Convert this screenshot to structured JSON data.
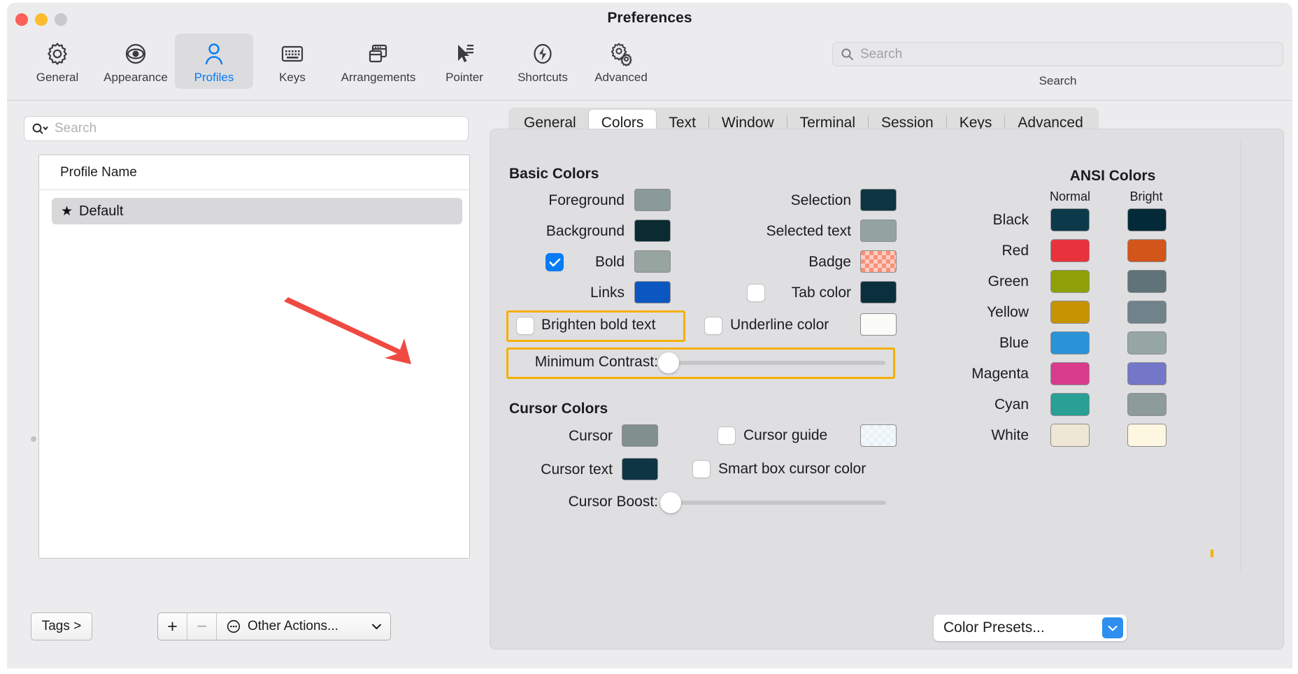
{
  "window": {
    "title": "Preferences",
    "traffic_lights": [
      "close-red",
      "minimize-yellow",
      "zoom-gray"
    ]
  },
  "toolbar": {
    "items": [
      {
        "label": "General",
        "icon": "gear-icon",
        "selected": false
      },
      {
        "label": "Appearance",
        "icon": "eye-icon",
        "selected": false
      },
      {
        "label": "Profiles",
        "icon": "person-icon",
        "selected": true
      },
      {
        "label": "Keys",
        "icon": "keyboard-icon",
        "selected": false
      },
      {
        "label": "Arrangements",
        "icon": "windows-icon",
        "selected": false
      },
      {
        "label": "Pointer",
        "icon": "cursor-icon",
        "selected": false
      },
      {
        "label": "Shortcuts",
        "icon": "bolt-icon",
        "selected": false
      },
      {
        "label": "Advanced",
        "icon": "double-gear-icon",
        "selected": false
      }
    ],
    "search": {
      "placeholder": "Search",
      "value": "",
      "caption": "Search",
      "icon": "search-icon"
    }
  },
  "sidebar": {
    "search": {
      "placeholder": "Search",
      "value": "",
      "icon": "search-dropdown-icon"
    },
    "list": {
      "header": "Profile Name",
      "rows": [
        {
          "name": "Default",
          "default_marker": "★",
          "selected": true
        }
      ]
    },
    "footer": {
      "tags_button": "Tags >",
      "add_button": "+",
      "remove_button": "−",
      "other_actions": "Other Actions...",
      "other_actions_icon": "ellipsis-circle-icon",
      "chevron": "⌄"
    }
  },
  "tabs": [
    {
      "label": "General",
      "active": false
    },
    {
      "label": "Colors",
      "active": true
    },
    {
      "label": "Text",
      "active": false
    },
    {
      "label": "Window",
      "active": false
    },
    {
      "label": "Terminal",
      "active": false
    },
    {
      "label": "Session",
      "active": false
    },
    {
      "label": "Keys",
      "active": false
    },
    {
      "label": "Advanced",
      "active": false
    }
  ],
  "colors_panel": {
    "basic_colors_title": "Basic Colors",
    "cursor_colors_title": "Cursor Colors",
    "ansi_title": "ANSI Colors",
    "basic_left": [
      {
        "label": "Foreground",
        "color": "#8a9999",
        "checkbox": null
      },
      {
        "label": "Background",
        "color": "#0b2b33",
        "checkbox": null
      },
      {
        "label": "Bold",
        "color": "#97a4a0",
        "checkbox": true
      },
      {
        "label": "Links",
        "color": "#0b57c2",
        "checkbox": null
      }
    ],
    "basic_right": [
      {
        "label": "Selection",
        "color": "#0d3543",
        "checkbox": null
      },
      {
        "label": "Selected text",
        "color": "#93a3a2",
        "checkbox": null
      },
      {
        "label": "Badge",
        "color": "#f79177",
        "checkbox": null,
        "alpha": true
      },
      {
        "label": "Tab color",
        "color": "#0b2f3d",
        "checkbox": false
      },
      {
        "label": "Underline color",
        "color": "#fbfbf8",
        "checkbox": false
      }
    ],
    "brighten_bold_text": {
      "label": "Brighten bold text",
      "checked": false,
      "highlighted": true
    },
    "minimum_contrast": {
      "label": "Minimum Contrast:",
      "value": 0,
      "highlighted": true
    },
    "cursor_left": [
      {
        "label": "Cursor",
        "color": "#818f8e"
      },
      {
        "label": "Cursor text",
        "color": "#0d3543"
      }
    ],
    "cursor_right": [
      {
        "label": "Cursor guide",
        "checked": false,
        "color": "#e8f2f8",
        "swatch": true
      },
      {
        "label": "Smart box cursor color",
        "checked": false,
        "swatch": false
      }
    ],
    "cursor_boost": {
      "label": "Cursor Boost:",
      "value": 0
    },
    "ansi_headers": {
      "normal": "Normal",
      "bright": "Bright"
    },
    "ansi_rows": [
      {
        "name": "Black",
        "normal": "#0d3a4b",
        "bright": "#032a38"
      },
      {
        "name": "Red",
        "normal": "#e8333c",
        "bright": "#d2551a"
      },
      {
        "name": "Green",
        "normal": "#8fa007",
        "bright": "#5f7378"
      },
      {
        "name": "Yellow",
        "normal": "#c69302",
        "bright": "#70828a"
      },
      {
        "name": "Blue",
        "normal": "#2a93d8",
        "bright": "#96a6a4"
      },
      {
        "name": "Magenta",
        "normal": "#d93b8d",
        "bright": "#7476c8"
      },
      {
        "name": "Cyan",
        "normal": "#28a096",
        "bright": "#8d9b99"
      },
      {
        "name": "White",
        "normal": "#eee7d3",
        "bright": "#fdf6e0"
      }
    ],
    "color_presets": {
      "label": "Color Presets...",
      "chevron": "⌄"
    }
  },
  "annotation": {
    "arrow_color": "#ef4a42",
    "highlight_color": "#f5b000"
  }
}
